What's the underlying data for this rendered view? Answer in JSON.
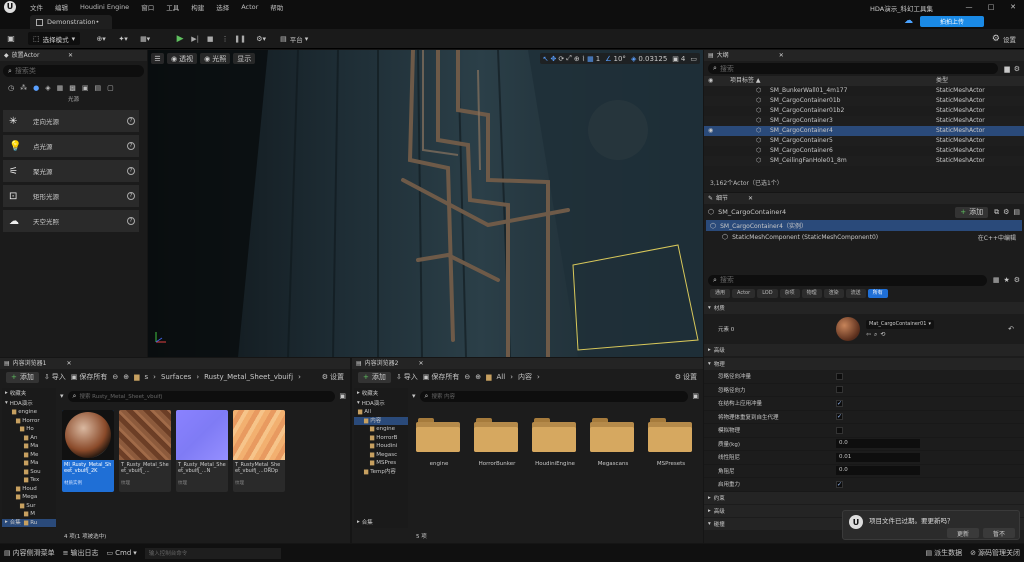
{
  "menu": [
    "文件",
    "编辑",
    "Houdini Engine",
    "窗口",
    "工具",
    "构建",
    "选择",
    "Actor",
    "帮助"
  ],
  "window": {
    "title": "HDA演示_科幻工具集",
    "share": "拍拍上传",
    "minimize": "—",
    "maximize": "□",
    "close": "✕"
  },
  "tab": {
    "label": "Demonstration•"
  },
  "toolbar": {
    "mode": "选择模式",
    "platform": "平台",
    "settings": "设置"
  },
  "place_actor": {
    "title": "放置Actor",
    "close": "✕",
    "search_placeholder": "搜索类",
    "category": "光源",
    "items": [
      "定向光源",
      "点光源",
      "聚光源",
      "矩形光源",
      "天空光照"
    ]
  },
  "viewport": {
    "btn_menu": "☰",
    "btn_persp": "透视",
    "btn_lit": "光照",
    "btn_show": "显示",
    "grid": "1",
    "angle": "10°",
    "scale": "0.03125",
    "cam": "4"
  },
  "outliner": {
    "title": "大纲",
    "close": "✕",
    "search_placeholder": "搜索",
    "col_label": "项目标签 ▲",
    "col_type": "类型",
    "rows": [
      {
        "name": "SM_BunkerWall01_4m177",
        "type": "StaticMeshActor"
      },
      {
        "name": "SM_CargoContainer01b",
        "type": "StaticMeshActor"
      },
      {
        "name": "SM_CargoContainer01b2",
        "type": "StaticMeshActor"
      },
      {
        "name": "SM_CargoContainer3",
        "type": "StaticMeshActor"
      },
      {
        "name": "SM_CargoContainer4",
        "type": "StaticMeshActor"
      },
      {
        "name": "SM_CargoContainer5",
        "type": "StaticMeshActor"
      },
      {
        "name": "SM_CargoContainer6",
        "type": "StaticMeshActor"
      },
      {
        "name": "SM_CeilingFanHole01_8m",
        "type": "StaticMeshActor"
      }
    ],
    "count": "3,162个Actor（已选1个）"
  },
  "details": {
    "title": "细节",
    "close": "✕",
    "actor_name": "SM_CargoContainer4",
    "add": "添加",
    "instance": "SM_CargoContainer4（实例）",
    "component": "StaticMeshComponent (StaticMeshComponent0)",
    "edit_cpp": "在C++中编辑",
    "search_placeholder": "搜索",
    "filters": [
      "通用",
      "Actor",
      "LOD",
      "杂项",
      "物理",
      "渲染",
      "流送",
      "所有"
    ],
    "material_section": "材质",
    "element": "元素 0",
    "material": "Mat_CargoContainer01",
    "sections": {
      "advanced": "高级",
      "physics": "物理",
      "constraints": "约束",
      "advanced2": "高级",
      "collision": "碰撞"
    },
    "physics_props": [
      {
        "label": "质量(kg)",
        "value": "0.0"
      },
      {
        "label": "线性阻尼",
        "value": "0.01"
      },
      {
        "label": "角阻尼",
        "value": "0.0"
      }
    ],
    "physics_checks": [
      "忽略径向冲量",
      "忽略径向力",
      "在结构上应用冲量",
      "将物理体重复到自生代理",
      "模拟物理",
      "启用重力"
    ]
  },
  "notify": {
    "text": "项目文件已过期。要更新吗？",
    "update": "更新",
    "later": "暂不"
  },
  "cb1": {
    "title": "内容浏览器1",
    "close": "✕",
    "add": "添加",
    "import": "导入",
    "save_all": "保存所有",
    "path": [
      "s",
      "Surfaces",
      "Rusty_Metal_Sheet_vbuifj"
    ],
    "settings": "设置",
    "search_placeholder": "搜索 Rusty_Metal_Sheet_vbuifj",
    "favorites": "收藏夹",
    "root": "HDA演示",
    "tree": [
      "engine",
      "Horror",
      "Ho",
      "An",
      "Ma",
      "Me",
      "Ma",
      "Sou",
      "Tex",
      "Houd",
      "Mega",
      "Sur",
      "M",
      "Ru"
    ],
    "assets": [
      {
        "name": "MI_Rusty_Metal_Sheet_vbuifj_2K",
        "type": "材质实例"
      },
      {
        "name": "T_Rusty_Metal_Sheet_vbuifj_...",
        "type": "纹理"
      },
      {
        "name": "T_Rusty_Metal_Sheet_vbuifj_...N",
        "type": "纹理"
      },
      {
        "name": "T_RustyMetal_Sheet_vbuifj_...ORDp",
        "type": "纹理"
      }
    ],
    "status": "4 项(1 项被选中)",
    "collections": "合集"
  },
  "cb2": {
    "title": "内容浏览器2",
    "close": "✕",
    "add": "添加",
    "import": "导入",
    "save_all": "保存所有",
    "path": [
      "All",
      "内容"
    ],
    "settings": "设置",
    "search_placeholder": "搜索 内容",
    "favorites": "收藏夹",
    "root": "HDA演示",
    "tree": [
      "All",
      "内容",
      "engine",
      "HorrorB",
      "Houdini",
      "Megasc",
      "MSPres",
      "Temp内容"
    ],
    "folders": [
      "engine",
      "HorrorBunker",
      "HoudiniEngine",
      "Megascans",
      "MSPresets"
    ],
    "status": "5 项",
    "collections": "合集"
  },
  "bottom": {
    "drawer": "内容侧滑菜单",
    "log": "输出日志",
    "cmd": "Cmd",
    "cmd_placeholder": "输入控制台命令",
    "derived": "派生数据",
    "source": "源码管理关闭"
  },
  "colors": {
    "accent": "#1f6fd6",
    "selected": "#2a4a7a",
    "panel": "#1c1c1c",
    "green": "#2f8f2f"
  }
}
